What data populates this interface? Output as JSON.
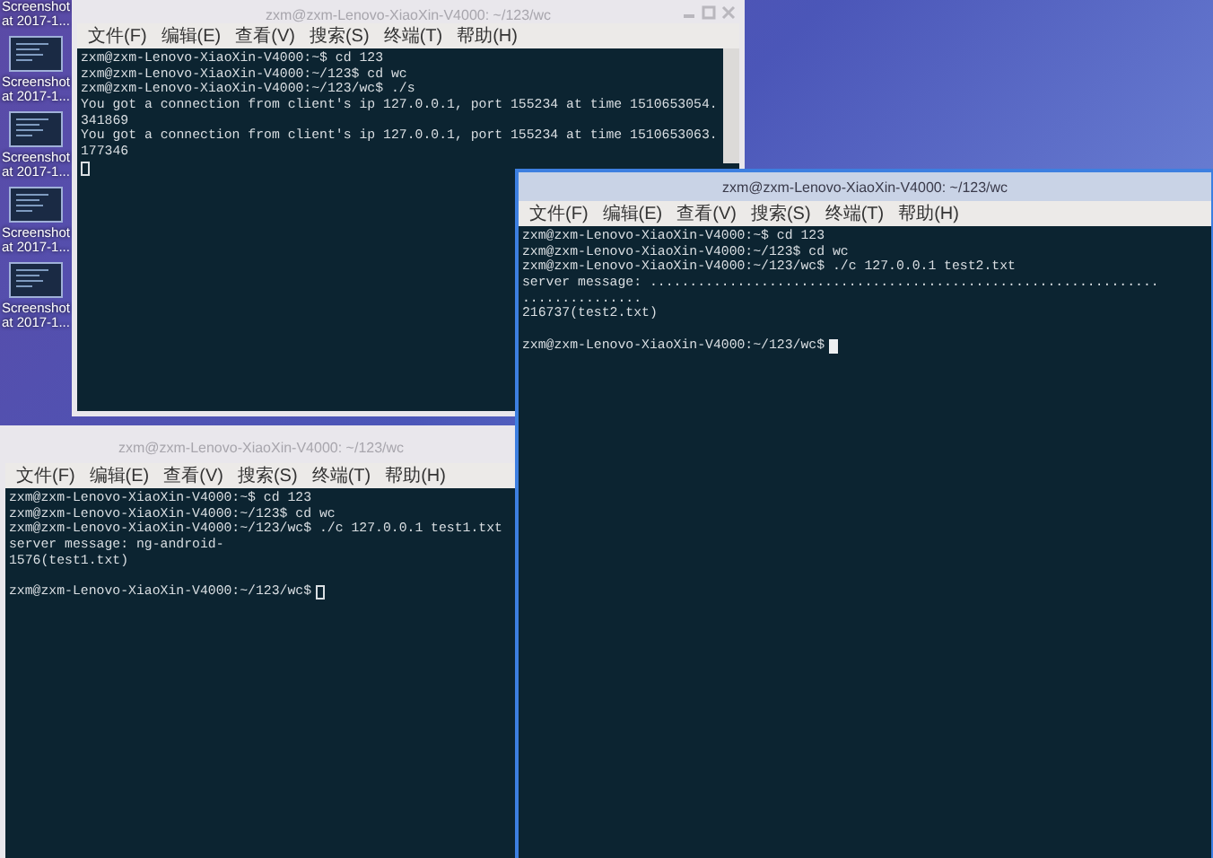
{
  "desktop": {
    "icons": [
      {
        "label": "Screenshot at 2017-1..."
      },
      {
        "label": "Screenshot at 2017-1..."
      },
      {
        "label": "Screenshot at 2017-1..."
      },
      {
        "label": "Screenshot at 2017-1..."
      },
      {
        "label": "Screenshot at 2017-1..."
      }
    ]
  },
  "windows": [
    {
      "title": "zxm@zxm-Lenovo-XiaoXin-V4000: ~/123/wc",
      "active": false,
      "scrollbar": true,
      "menu": [
        "文件(F)",
        "编辑(E)",
        "查看(V)",
        "搜索(S)",
        "终端(T)",
        "帮助(H)"
      ],
      "lines": [
        {
          "kind": "text",
          "text": "zxm@zxm-Lenovo-XiaoXin-V4000:~$ cd 123"
        },
        {
          "kind": "text",
          "text": "zxm@zxm-Lenovo-XiaoXin-V4000:~/123$ cd wc"
        },
        {
          "kind": "text",
          "text": "zxm@zxm-Lenovo-XiaoXin-V4000:~/123/wc$ ./s"
        },
        {
          "kind": "text",
          "text": "You got a connection from client's ip 127.0.0.1, port 155234 at time 1510653054."
        },
        {
          "kind": "text",
          "text": "341869"
        },
        {
          "kind": "text",
          "text": "You got a connection from client's ip 127.0.0.1, port 155234 at time 1510653063."
        },
        {
          "kind": "text",
          "text": "177346"
        },
        {
          "kind": "cursor"
        }
      ]
    },
    {
      "title": "zxm@zxm-Lenovo-XiaoXin-V4000: ~/123/wc",
      "active": false,
      "scrollbar": false,
      "menu": [
        "文件(F)",
        "编辑(E)",
        "查看(V)",
        "搜索(S)",
        "终端(T)",
        "帮助(H)"
      ],
      "lines": [
        {
          "kind": "text",
          "text": "zxm@zxm-Lenovo-XiaoXin-V4000:~$ cd 123"
        },
        {
          "kind": "text",
          "text": "zxm@zxm-Lenovo-XiaoXin-V4000:~/123$ cd wc"
        },
        {
          "kind": "text",
          "text": "zxm@zxm-Lenovo-XiaoXin-V4000:~/123/wc$ ./c 127.0.0.1 test1.txt"
        },
        {
          "kind": "text",
          "text": "server message: ng-android-"
        },
        {
          "kind": "text",
          "text": "1576(test1.txt)"
        },
        {
          "kind": "blank"
        },
        {
          "kind": "prompt",
          "text": "zxm@zxm-Lenovo-XiaoXin-V4000:~/123/wc$"
        }
      ]
    },
    {
      "title": "zxm@zxm-Lenovo-XiaoXin-V4000: ~/123/wc",
      "active": true,
      "scrollbar": false,
      "menu": [
        "文件(F)",
        "编辑(E)",
        "查看(V)",
        "搜索(S)",
        "终端(T)",
        "帮助(H)"
      ],
      "lines": [
        {
          "kind": "text",
          "text": "zxm@zxm-Lenovo-XiaoXin-V4000:~$ cd 123"
        },
        {
          "kind": "text",
          "text": "zxm@zxm-Lenovo-XiaoXin-V4000:~/123$ cd wc"
        },
        {
          "kind": "text",
          "text": "zxm@zxm-Lenovo-XiaoXin-V4000:~/123/wc$ ./c 127.0.0.1 test2.txt"
        },
        {
          "kind": "text",
          "text": "server message: ................................................................"
        },
        {
          "kind": "text",
          "text": "..............."
        },
        {
          "kind": "text",
          "text": "216737(test2.txt)"
        },
        {
          "kind": "blank"
        },
        {
          "kind": "prompt",
          "text": "zxm@zxm-Lenovo-XiaoXin-V4000:~/123/wc$"
        }
      ]
    }
  ]
}
